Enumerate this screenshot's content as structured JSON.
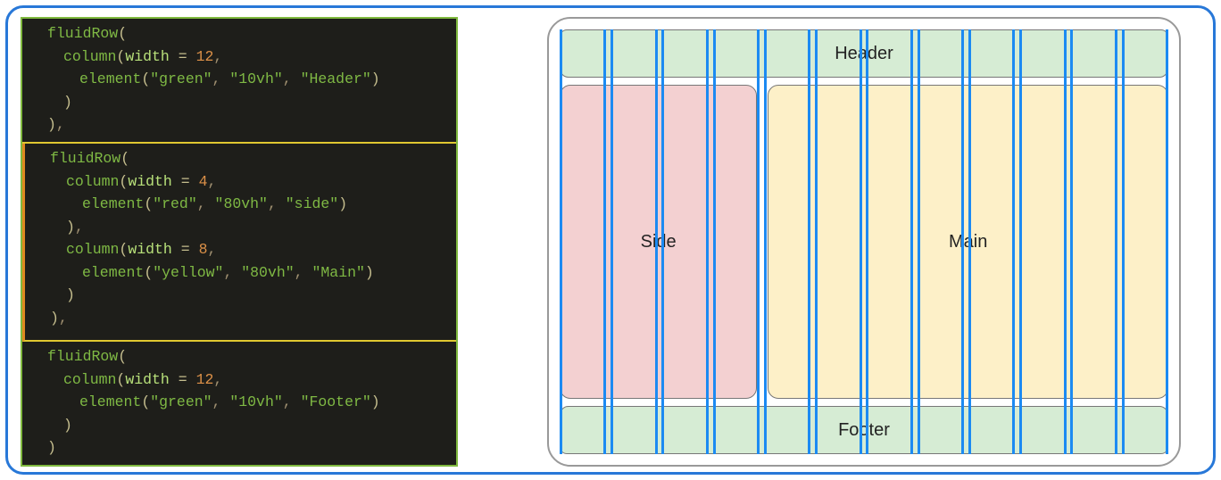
{
  "code": {
    "blocks": [
      {
        "lines": [
          {
            "ind": 1,
            "tokens": [
              {
                "t": "fn",
                "v": "fluidRow"
              },
              {
                "t": "par",
                "v": "("
              }
            ]
          },
          {
            "ind": 2,
            "tokens": [
              {
                "t": "fn",
                "v": "column"
              },
              {
                "t": "par",
                "v": "("
              },
              {
                "t": "key",
                "v": "width"
              },
              {
                "t": "eq",
                "v": " = "
              },
              {
                "t": "num",
                "v": "12"
              },
              {
                "t": "comma",
                "v": ","
              }
            ]
          },
          {
            "ind": 3,
            "tokens": [
              {
                "t": "fn",
                "v": "element"
              },
              {
                "t": "par",
                "v": "("
              },
              {
                "t": "str",
                "v": "\"green\""
              },
              {
                "t": "comma",
                "v": ", "
              },
              {
                "t": "str",
                "v": "\"10vh\""
              },
              {
                "t": "comma",
                "v": ", "
              },
              {
                "t": "str",
                "v": "\"Header\""
              },
              {
                "t": "par",
                "v": ")"
              }
            ]
          },
          {
            "ind": 2,
            "tokens": [
              {
                "t": "par",
                "v": ")"
              }
            ]
          },
          {
            "ind": 1,
            "tokens": [
              {
                "t": "par",
                "v": ")"
              },
              {
                "t": "comma",
                "v": ","
              }
            ]
          }
        ]
      },
      {
        "lines": [
          {
            "ind": 1,
            "tokens": [
              {
                "t": "fn",
                "v": "fluidRow"
              },
              {
                "t": "par",
                "v": "("
              }
            ]
          },
          {
            "ind": 2,
            "tokens": [
              {
                "t": "fn",
                "v": "column"
              },
              {
                "t": "par",
                "v": "("
              },
              {
                "t": "key",
                "v": "width"
              },
              {
                "t": "eq",
                "v": " = "
              },
              {
                "t": "num",
                "v": "4"
              },
              {
                "t": "comma",
                "v": ","
              }
            ]
          },
          {
            "ind": 3,
            "tokens": [
              {
                "t": "fn",
                "v": "element"
              },
              {
                "t": "par",
                "v": "("
              },
              {
                "t": "str",
                "v": "\"red\""
              },
              {
                "t": "comma",
                "v": ", "
              },
              {
                "t": "str",
                "v": "\"80vh\""
              },
              {
                "t": "comma",
                "v": ", "
              },
              {
                "t": "str",
                "v": "\"side\""
              },
              {
                "t": "par",
                "v": ")"
              }
            ]
          },
          {
            "ind": 2,
            "tokens": [
              {
                "t": "par",
                "v": ")"
              },
              {
                "t": "comma",
                "v": ","
              }
            ]
          },
          {
            "ind": 2,
            "tokens": [
              {
                "t": "fn",
                "v": "column"
              },
              {
                "t": "par",
                "v": "("
              },
              {
                "t": "key",
                "v": "width"
              },
              {
                "t": "eq",
                "v": " = "
              },
              {
                "t": "num",
                "v": "8"
              },
              {
                "t": "comma",
                "v": ","
              }
            ]
          },
          {
            "ind": 3,
            "tokens": [
              {
                "t": "fn",
                "v": "element"
              },
              {
                "t": "par",
                "v": "("
              },
              {
                "t": "str",
                "v": "\"yellow\""
              },
              {
                "t": "comma",
                "v": ", "
              },
              {
                "t": "str",
                "v": "\"80vh\""
              },
              {
                "t": "comma",
                "v": ", "
              },
              {
                "t": "str",
                "v": "\"Main\""
              },
              {
                "t": "par",
                "v": ")"
              }
            ]
          },
          {
            "ind": 2,
            "tokens": [
              {
                "t": "par",
                "v": ")"
              }
            ]
          },
          {
            "ind": 1,
            "tokens": [
              {
                "t": "par",
                "v": ")"
              },
              {
                "t": "comma",
                "v": ","
              }
            ]
          }
        ]
      },
      {
        "lines": [
          {
            "ind": 1,
            "tokens": [
              {
                "t": "fn",
                "v": "fluidRow"
              },
              {
                "t": "par",
                "v": "("
              }
            ]
          },
          {
            "ind": 2,
            "tokens": [
              {
                "t": "fn",
                "v": "column"
              },
              {
                "t": "par",
                "v": "("
              },
              {
                "t": "key",
                "v": "width"
              },
              {
                "t": "eq",
                "v": " = "
              },
              {
                "t": "num",
                "v": "12"
              },
              {
                "t": "comma",
                "v": ","
              }
            ]
          },
          {
            "ind": 3,
            "tokens": [
              {
                "t": "fn",
                "v": "element"
              },
              {
                "t": "par",
                "v": "("
              },
              {
                "t": "str",
                "v": "\"green\""
              },
              {
                "t": "comma",
                "v": ", "
              },
              {
                "t": "str",
                "v": "\"10vh\""
              },
              {
                "t": "comma",
                "v": ", "
              },
              {
                "t": "str",
                "v": "\"Footer\""
              },
              {
                "t": "par",
                "v": ")"
              }
            ]
          },
          {
            "ind": 2,
            "tokens": [
              {
                "t": "par",
                "v": ")"
              }
            ]
          },
          {
            "ind": 1,
            "tokens": [
              {
                "t": "par",
                "v": ")"
              }
            ]
          }
        ]
      }
    ]
  },
  "layout": {
    "grid_columns": 12,
    "header_label": "Header",
    "side_label": "Side",
    "main_label": "Main",
    "footer_label": "Footer",
    "colors": {
      "header": "#d6ecd4",
      "side": "#f3d0d1",
      "main": "#fdf0c8",
      "footer": "#d6ecd4",
      "grid_line": "#1c8af2"
    }
  }
}
